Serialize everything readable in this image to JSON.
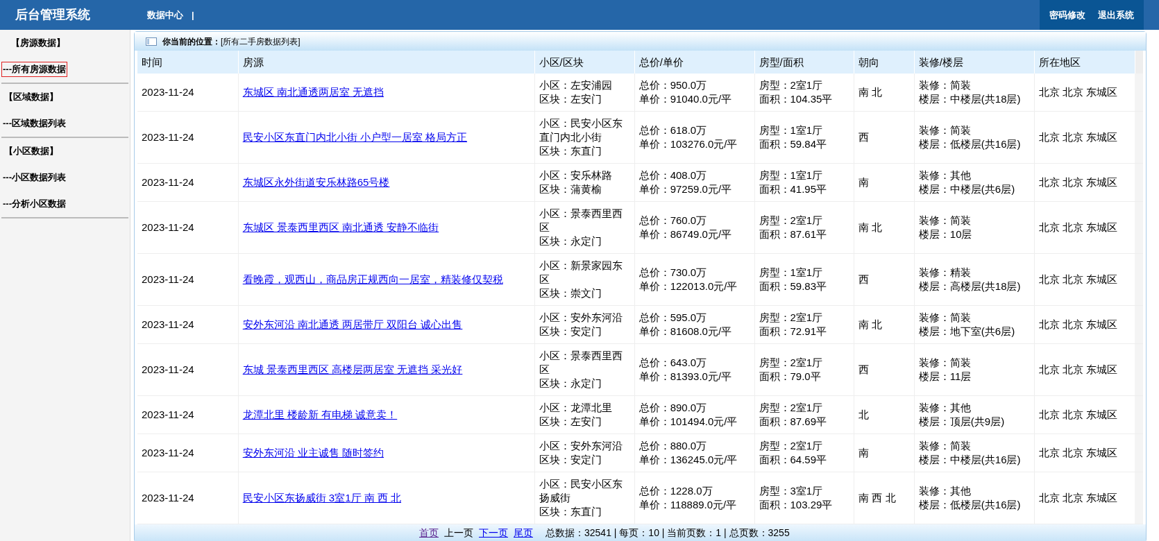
{
  "header": {
    "title": "后台管理系统",
    "nav": [
      {
        "label": "数据中心"
      }
    ],
    "separator": "|",
    "actions": [
      {
        "label": "密码修改"
      },
      {
        "label": "退出系统"
      }
    ]
  },
  "sidebar": {
    "groups": [
      {
        "title": "【房源数据】",
        "items": [
          {
            "label": "---所有房源数据",
            "selected": true
          }
        ]
      },
      {
        "title": "【区域数据】",
        "items": [
          {
            "label": "---区域数据列表",
            "selected": false
          }
        ]
      },
      {
        "title": "【小区数据】",
        "items": [
          {
            "label": "---小区数据列表",
            "selected": false
          },
          {
            "label": "---分析小区数据",
            "selected": false
          }
        ]
      }
    ]
  },
  "breadcrumb": {
    "label": "你当前的位置：",
    "path": "[所有二手房数据列表]"
  },
  "table": {
    "columns": [
      "时间",
      "房源",
      "小区/区块",
      "总价/单价",
      "房型/面积",
      "朝向",
      "装修/楼层",
      "所在地区"
    ],
    "rows": [
      {
        "date": "2023-11-24",
        "title": "东城区 南北通透两居室 无遮挡",
        "community": "小区：左安浦园",
        "block": "区块：左安门",
        "total": "总价：950.0万",
        "unit": "单价：91040.0元/平",
        "layout": "房型：2室1厅",
        "area": "面积：104.35平",
        "orientation": "南 北",
        "decoration": "装修：简装",
        "floor": "楼层：中楼层(共18层)",
        "region": "北京 北京 东城区"
      },
      {
        "date": "2023-11-24",
        "title": "民安小区东直门内北小街 小户型一居室 格局方正",
        "community": "小区：民安小区东直门内北小街",
        "block": "区块：东直门",
        "total": "总价：618.0万",
        "unit": "单价：103276.0元/平",
        "layout": "房型：1室1厅",
        "area": "面积：59.84平",
        "orientation": "西",
        "decoration": "装修：简装",
        "floor": "楼层：低楼层(共16层)",
        "region": "北京 北京 东城区"
      },
      {
        "date": "2023-11-24",
        "title": "东城区永外街道安乐林路65号楼",
        "community": "小区：安乐林路",
        "block": "区块：蒲黄榆",
        "total": "总价：408.0万",
        "unit": "单价：97259.0元/平",
        "layout": "房型：1室1厅",
        "area": "面积：41.95平",
        "orientation": "南",
        "decoration": "装修：其他",
        "floor": "楼层：中楼层(共6层)",
        "region": "北京 北京 东城区"
      },
      {
        "date": "2023-11-24",
        "title": "东城区 景泰西里西区 南北通透 安静不临街",
        "community": "小区：景泰西里西区",
        "block": "区块：永定门",
        "total": "总价：760.0万",
        "unit": "单价：86749.0元/平",
        "layout": "房型：2室1厅",
        "area": "面积：87.61平",
        "orientation": "南 北",
        "decoration": "装修：简装",
        "floor": "楼层：10层",
        "region": "北京 北京 东城区"
      },
      {
        "date": "2023-11-24",
        "title": "看晚霞，观西山，商品房正规西向一居室，精装修仅契税",
        "community": "小区：新景家园东区",
        "block": "区块：崇文门",
        "total": "总价：730.0万",
        "unit": "单价：122013.0元/平",
        "layout": "房型：1室1厅",
        "area": "面积：59.83平",
        "orientation": "西",
        "decoration": "装修：精装",
        "floor": "楼层：高楼层(共18层)",
        "region": "北京 北京 东城区"
      },
      {
        "date": "2023-11-24",
        "title": "安外东河沿 南北通透 两居带厅 双阳台 诚心出售",
        "community": "小区：安外东河沿",
        "block": "区块：安定门",
        "total": "总价：595.0万",
        "unit": "单价：81608.0元/平",
        "layout": "房型：2室1厅",
        "area": "面积：72.91平",
        "orientation": "南 北",
        "decoration": "装修：简装",
        "floor": "楼层：地下室(共6层)",
        "region": "北京 北京 东城区"
      },
      {
        "date": "2023-11-24",
        "title": "东城 景泰西里西区 高楼层两居室 无遮挡 采光好",
        "community": "小区：景泰西里西区",
        "block": "区块：永定门",
        "total": "总价：643.0万",
        "unit": "单价：81393.0元/平",
        "layout": "房型：2室1厅",
        "area": "面积：79.0平",
        "orientation": "西",
        "decoration": "装修：简装",
        "floor": "楼层：11层",
        "region": "北京 北京 东城区"
      },
      {
        "date": "2023-11-24",
        "title": "龙潭北里 楼龄新 有电梯 诚意卖！",
        "community": "小区：龙潭北里",
        "block": "区块：左安门",
        "total": "总价：890.0万",
        "unit": "单价：101494.0元/平",
        "layout": "房型：2室1厅",
        "area": "面积：87.69平",
        "orientation": "北",
        "decoration": "装修：其他",
        "floor": "楼层：顶层(共9层)",
        "region": "北京 北京 东城区"
      },
      {
        "date": "2023-11-24",
        "title": "安外东河沿 业主诚售 随时签约",
        "community": "小区：安外东河沿",
        "block": "区块：安定门",
        "total": "总价：880.0万",
        "unit": "单价：136245.0元/平",
        "layout": "房型：2室1厅",
        "area": "面积：64.59平",
        "orientation": "南",
        "decoration": "装修：简装",
        "floor": "楼层：中楼层(共16层)",
        "region": "北京 北京 东城区"
      },
      {
        "date": "2023-11-24",
        "title": "民安小区东扬威街 3室1厅 南 西 北",
        "community": "小区：民安小区东扬威街",
        "block": "区块：东直门",
        "total": "总价：1228.0万",
        "unit": "单价：118889.0元/平",
        "layout": "房型：3室1厅",
        "area": "面积：103.29平",
        "orientation": "南 西 北",
        "decoration": "装修：其他",
        "floor": "楼层：低楼层(共16层)",
        "region": "北京 北京 东城区"
      }
    ]
  },
  "pagination": {
    "links": [
      {
        "label": "首页",
        "kind": "visited"
      },
      {
        "label": "上一页",
        "kind": "disabled"
      },
      {
        "label": "下一页",
        "kind": "link"
      },
      {
        "label": "尾页",
        "kind": "link"
      }
    ],
    "summary": "总数据：32541 | 每页：10 | 当前页数：1 | 总页数：3255"
  }
}
